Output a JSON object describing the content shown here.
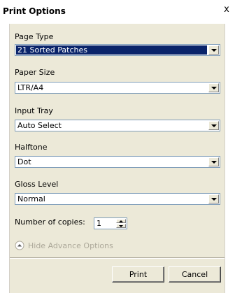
{
  "window": {
    "title": "Print Options",
    "close_glyph": "x"
  },
  "fields": {
    "page_type": {
      "label": "Page Type",
      "value": "21 Sorted Patches"
    },
    "paper_size": {
      "label": "Paper Size",
      "value": "LTR/A4"
    },
    "input_tray": {
      "label": "Input Tray",
      "value": "Auto Select"
    },
    "halftone": {
      "label": "Halftone",
      "value": "Dot"
    },
    "gloss_level": {
      "label": "Gloss Level",
      "value": "Normal"
    }
  },
  "copies": {
    "label": "Number of copies:",
    "value": "1"
  },
  "advance": {
    "label": "Hide Advance Options",
    "icon": "chevron-up-circle-icon"
  },
  "buttons": {
    "print": "Print",
    "cancel": "Cancel"
  },
  "colors": {
    "selection": "#0a246a",
    "panel": "#ece9d8",
    "disabled_text": "#aca899"
  }
}
